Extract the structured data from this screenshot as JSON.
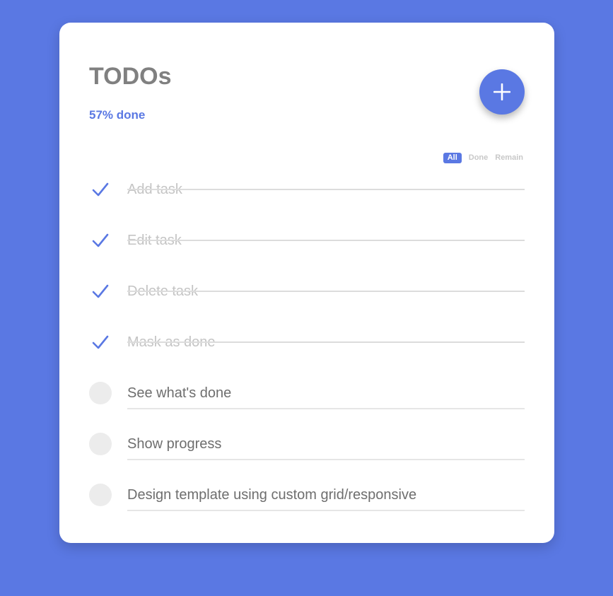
{
  "header": {
    "title": "TODOs",
    "progress_text": "57% done"
  },
  "filters": [
    {
      "label": "All",
      "active": true
    },
    {
      "label": "Done",
      "active": false
    },
    {
      "label": "Remain",
      "active": false
    }
  ],
  "tasks": [
    {
      "label": "Add task",
      "done": true
    },
    {
      "label": "Edit task",
      "done": true
    },
    {
      "label": "Delete task",
      "done": true
    },
    {
      "label": "Mask as done",
      "done": true
    },
    {
      "label": "See what's done",
      "done": false
    },
    {
      "label": "Show progress",
      "done": false
    },
    {
      "label": "Design template using custom grid/responsive",
      "done": false
    }
  ],
  "icons": {
    "add": "plus-icon",
    "done": "checkmark-icon"
  },
  "colors": {
    "background": "#5a78e3",
    "accent": "#5a78e3",
    "card": "#ffffff"
  }
}
